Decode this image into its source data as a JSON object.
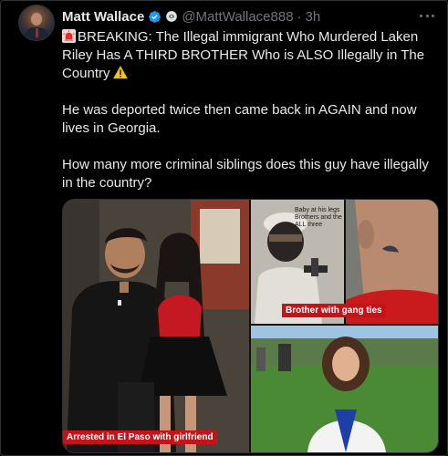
{
  "tweet": {
    "author_name": "Matt Wallace",
    "handle": "@MattWallace888",
    "separator": "·",
    "time": "3h",
    "paragraph1_before": "BREAKING: The Illegal immigrant Who Murdered Laken Riley Has A THIRD BROTHER  Who is ALSO Illegally in The Country",
    "paragraph2": "He was deported twice then came back in AGAIN and now lives in Georgia.",
    "paragraph3": "How many more criminal siblings does this guy have illegally in the country?"
  },
  "icons": {
    "verified": "verified-badge-icon",
    "affiliation": "affiliation-badge-icon",
    "siren": "siren-emoji-icon",
    "warning": "warning-emoji-icon",
    "more": "more-options-icon"
  },
  "media": {
    "caption_left": "Arrested in El Paso with girlfriend",
    "caption_right": "Brother with gang ties",
    "overlay_text_lines": [
      "Baby at his legs",
      "Brothers and the",
      "ALL three"
    ]
  },
  "colors": {
    "background": "#000000",
    "text": "#e7e9ea",
    "muted": "#71767b",
    "verified": "#1d9bf0",
    "caption_bg": "#c4141a"
  }
}
